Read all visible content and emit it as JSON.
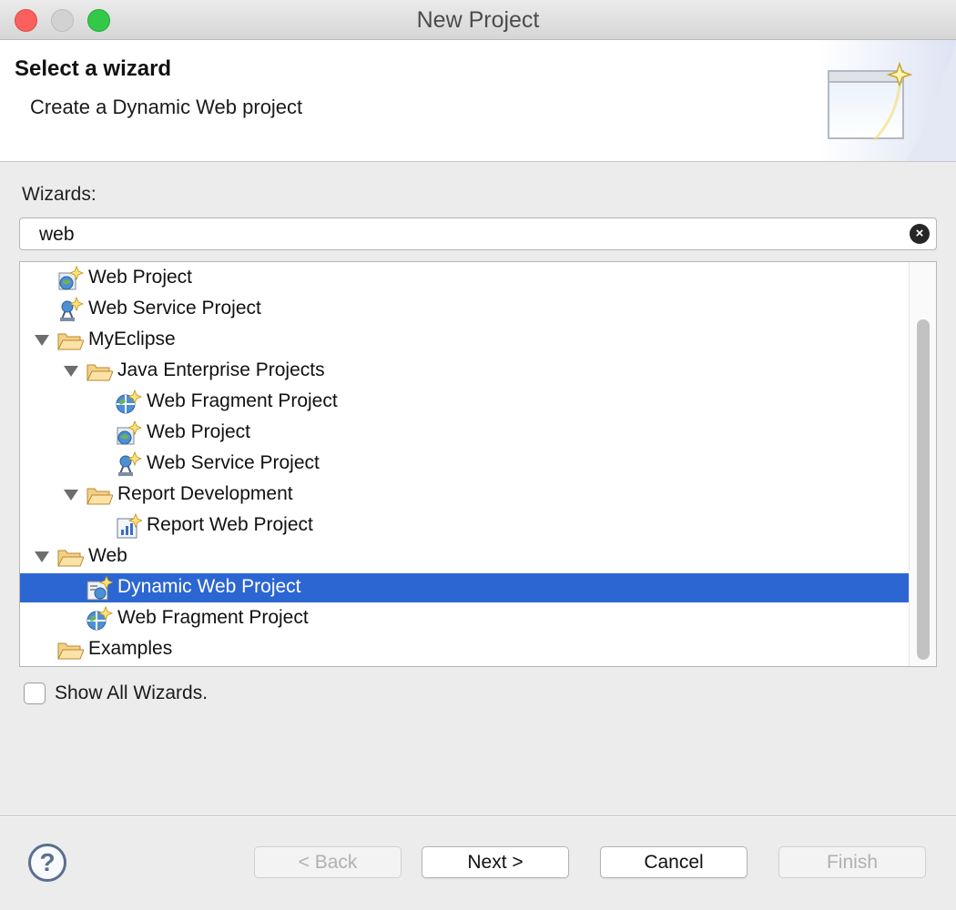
{
  "window": {
    "title": "New Project"
  },
  "header": {
    "title": "Select a wizard",
    "description": "Create a Dynamic Web project"
  },
  "wizards": {
    "label": "Wizards:",
    "filter_value": "web",
    "items": [
      {
        "label": "Web Project",
        "icon": "web-project-icon"
      },
      {
        "label": "Web Service Project",
        "icon": "web-service-icon"
      },
      {
        "label": "MyEclipse",
        "icon": "folder-open-icon",
        "expanded": true
      },
      {
        "label": "Java Enterprise Projects",
        "icon": "folder-open-icon",
        "expanded": true
      },
      {
        "label": "Web Fragment Project",
        "icon": "web-fragment-icon"
      },
      {
        "label": "Web Project",
        "icon": "web-project-icon"
      },
      {
        "label": "Web Service Project",
        "icon": "web-service-icon"
      },
      {
        "label": "Report Development",
        "icon": "folder-open-icon",
        "expanded": true
      },
      {
        "label": "Report Web Project",
        "icon": "report-project-icon"
      },
      {
        "label": "Web",
        "icon": "folder-open-icon",
        "expanded": true
      },
      {
        "label": "Dynamic Web Project",
        "icon": "dynamic-web-project-icon",
        "selected": true
      },
      {
        "label": "Web Fragment Project",
        "icon": "web-fragment-icon"
      },
      {
        "label": "Examples",
        "icon": "folder-open-icon"
      }
    ]
  },
  "show_all": {
    "label": "Show All Wizards.",
    "checked": false
  },
  "buttons": {
    "back": "< Back",
    "next": "Next >",
    "cancel": "Cancel",
    "finish": "Finish"
  },
  "colors": {
    "selection": "#2c66d3"
  }
}
